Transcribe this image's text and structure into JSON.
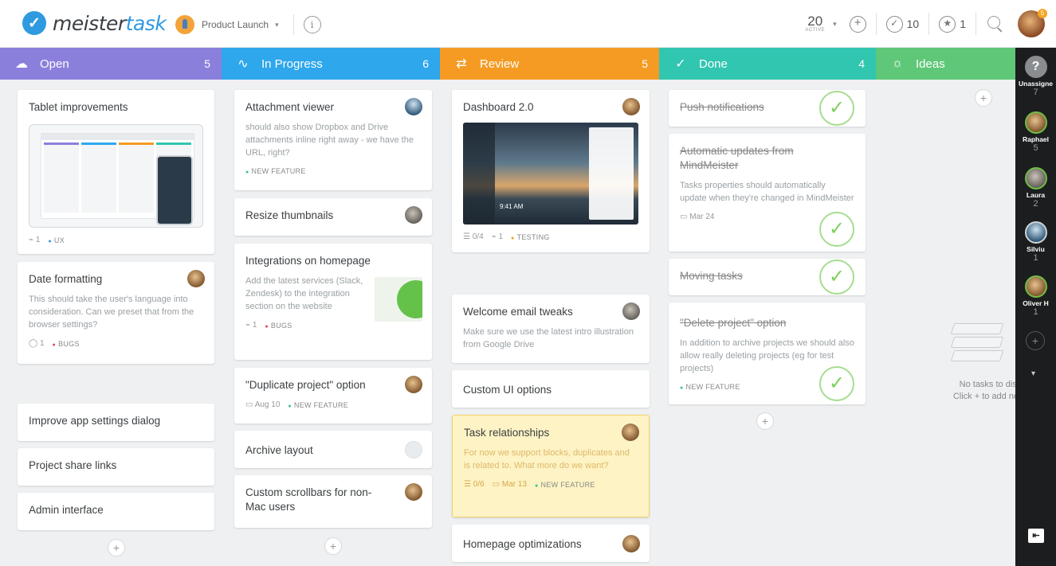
{
  "app": {
    "logo_part1": "meister",
    "logo_part2": "task",
    "logo_check": "✓"
  },
  "topbar": {
    "project_name": "Product Launch",
    "active_count": "20",
    "active_label": "ACTIVE",
    "completed_count": "10",
    "watched_count": "1",
    "user_badge": "5"
  },
  "columns": [
    {
      "title": "Open",
      "count": "5",
      "color": "#8b7fdc",
      "icon": "cloud-icon",
      "glyph": "☁"
    },
    {
      "title": "In Progress",
      "count": "6",
      "color": "#2ea7ec",
      "icon": "pulse-icon",
      "glyph": "∿"
    },
    {
      "title": "Review",
      "count": "5",
      "color": "#f59b23",
      "icon": "split-arrow-icon",
      "glyph": "⇄"
    },
    {
      "title": "Done",
      "count": "4",
      "color": "#30c6b0",
      "icon": "check-circle-icon",
      "glyph": "✓"
    },
    {
      "title": "Ideas",
      "count": "",
      "color": "#5ec778",
      "icon": "lightbulb-icon",
      "glyph": "☼"
    }
  ],
  "open": {
    "tablet": {
      "title": "Tablet improvements",
      "attachments": "1",
      "tag": "UX"
    },
    "date_format": {
      "title": "Date formatting",
      "desc": "This should take the user's language into consideration. Can we preset that from the browser settings?",
      "comments": "1",
      "tag": "BUGS"
    },
    "settings": {
      "title": "Improve app settings dialog"
    },
    "share": {
      "title": "Project share links"
    },
    "admin": {
      "title": "Admin interface"
    }
  },
  "progress": {
    "attach": {
      "title": "Attachment viewer",
      "desc": "should also show Dropbox and Drive attachments inline right away - we have the URL, right?",
      "tag": "NEW FEATURE"
    },
    "resize": {
      "title": "Resize thumbnails"
    },
    "integr": {
      "title": "Integrations on homepage",
      "desc": "Add the latest services (Slack, Zendesk) to the integration section on the website",
      "attachments": "1",
      "tag": "BUGS"
    },
    "duplicate": {
      "title": "\"Duplicate project\" option",
      "date": "Aug 10",
      "tag": "NEW FEATURE"
    },
    "archive": {
      "title": "Archive layout"
    },
    "scroll": {
      "title": "Custom scrollbars for non-Mac users"
    }
  },
  "review": {
    "dash": {
      "title": "Dashboard 2.0",
      "checklist": "0/4",
      "attachments": "1",
      "tag": "TESTING",
      "thumb_time": "9:41 AM"
    },
    "welcome": {
      "title": "Welcome email tweaks",
      "desc": "Make sure we use the latest intro illustration from Google Drive"
    },
    "custom_ui": {
      "title": "Custom UI options"
    },
    "relations": {
      "title": "Task relationships",
      "desc": "For now we support blocks, duplicates and is related to. What more do we want?",
      "checklist": "0/6",
      "date": "Mar 13",
      "tag": "NEW FEATURE"
    },
    "homepage": {
      "title": "Homepage optimizations"
    }
  },
  "done": {
    "push": {
      "title": "Push notifications"
    },
    "auto": {
      "title": "Automatic updates from MindMeister",
      "desc": "Tasks properties should automatically update when they're changed in MindMeister",
      "date": "Mar 24"
    },
    "moving": {
      "title": "Moving tasks"
    },
    "delete": {
      "title": "\"Delete project\" option",
      "desc": "In addition to archive projects we should also allow really deleting projects (eg for test projects)",
      "tag": "NEW FEATURE"
    }
  },
  "ideas": {
    "empty_line1": "No tasks to displ",
    "empty_line2": "Click + to add new t"
  },
  "members": [
    {
      "name": "Unassigne",
      "count": "7"
    },
    {
      "name": "Raphael",
      "count": "5"
    },
    {
      "name": "Laura",
      "count": "2"
    },
    {
      "name": "Silviu",
      "count": "1"
    },
    {
      "name": "Oliver H",
      "count": "1"
    }
  ],
  "symbols": {
    "plus": "+",
    "question": "?",
    "check": "✓",
    "info": "i",
    "caret": "▾",
    "star": "★",
    "exit": "⇤"
  }
}
